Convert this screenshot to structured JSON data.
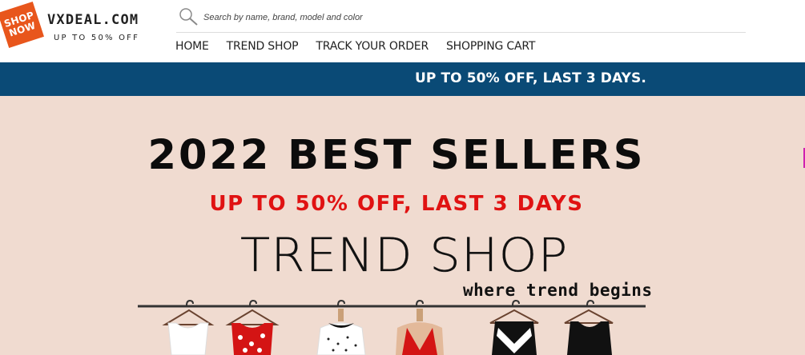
{
  "brand": {
    "badge_line1": "SHOP",
    "badge_line2": "NOW",
    "name": "VXDEAL.COM",
    "tagline": "UP TO 50% OFF",
    "badge_color": "#e8561c"
  },
  "search": {
    "placeholder": "Search by name, brand, model and color",
    "value": "",
    "icon": "search-icon"
  },
  "nav": {
    "items": [
      {
        "label": "HOME"
      },
      {
        "label": "TREND SHOP"
      },
      {
        "label": "TRACK YOUR ORDER"
      },
      {
        "label": "SHOPPING CART"
      }
    ]
  },
  "promo_bar": {
    "text": "UP TO 50% OFF, LAST 3 DAYS.",
    "background": "#0a4a76"
  },
  "banner": {
    "title": "2022 BEST SELLERS",
    "subtitle": "UP TO 50% OFF, LAST 3 DAYS",
    "shop_name": "TREND SHOP",
    "shop_tagline": "where trend begins",
    "background": "#f0dbd0",
    "accent": "#e01212"
  }
}
